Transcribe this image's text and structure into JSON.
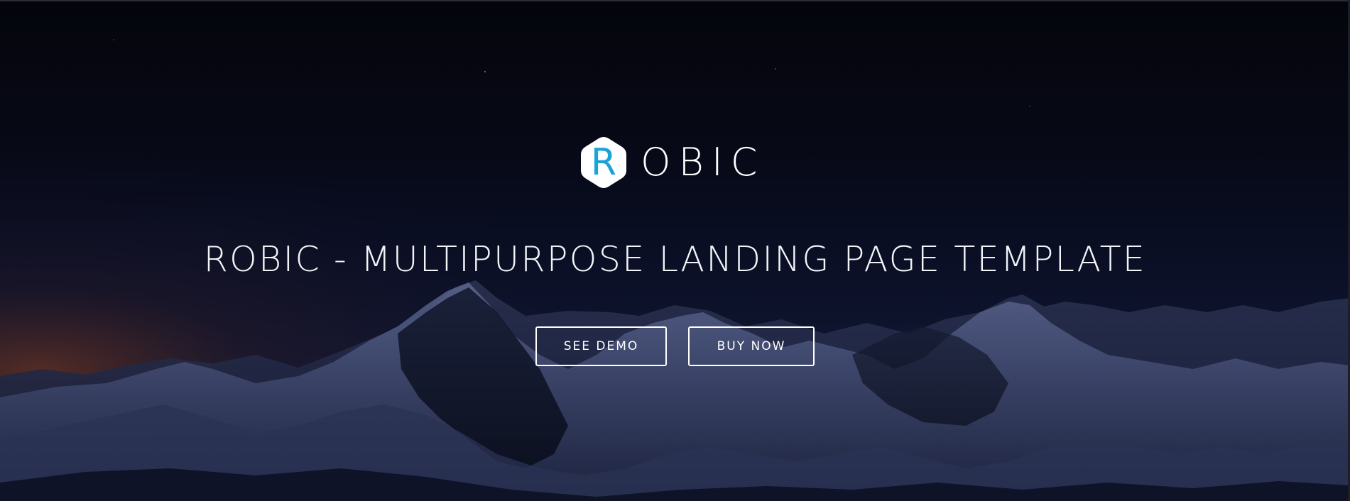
{
  "brand": {
    "logo_letter": "R",
    "logo_wordmark": "OBIC",
    "accent_color": "#1aa3d6"
  },
  "hero": {
    "title": "ROBIC - MULTIPURPOSE LANDING PAGE TEMPLATE",
    "background": "night mountain range"
  },
  "actions": {
    "see_demo_label": "SEE DEMO",
    "buy_now_label": "BUY NOW"
  }
}
